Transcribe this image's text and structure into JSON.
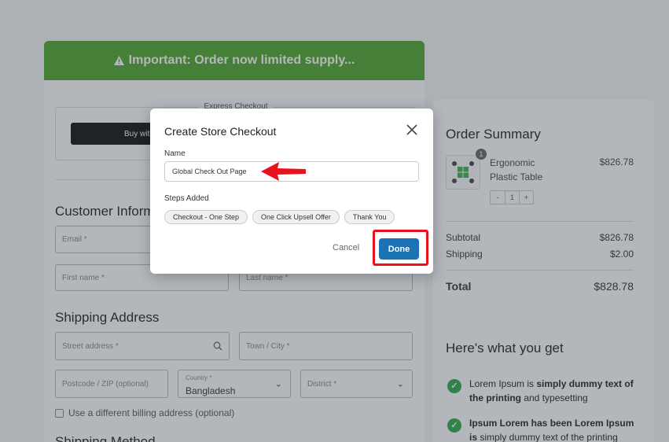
{
  "banner": {
    "icon": "warning-icon",
    "text": "Important: Order now limited supply..."
  },
  "express": {
    "label": "Express Checkout",
    "buy_button": "Buy with"
  },
  "customer": {
    "title": "Customer Inform",
    "email_placeholder": "Email *",
    "first_name_placeholder": "First name *",
    "last_name_placeholder": "Last name *"
  },
  "shipping": {
    "title": "Shipping Address",
    "street_placeholder": "Street address *",
    "town_placeholder": "Town / City *",
    "postcode_placeholder": "Postcode / ZIP (optional)",
    "country_label": "Country *",
    "country_value": "Bangladesh",
    "district_placeholder": "District *",
    "billing_checkbox": "Use a different billing address (optional)",
    "method_title": "Shipping Method"
  },
  "summary": {
    "title": "Order Summary",
    "item_qty_badge": "1",
    "product_name": "Ergonomic Plastic Table",
    "product_price": "$826.78",
    "qty_minus": "-",
    "qty_value": "1",
    "qty_plus": "+",
    "subtotal_label": "Subtotal",
    "subtotal_value": "$826.78",
    "shipping_label": "Shipping",
    "shipping_value": "$2.00",
    "total_label": "Total",
    "total_value": "$828.78"
  },
  "benefits": {
    "title": "Here's what you get",
    "item1_a": "Lorem Ipsum is ",
    "item1_b": "simply dummy text of the printing",
    "item1_c": " and typesetting",
    "item2_a": "Ipsum Lorem has been Lorem Ipsum is",
    "item2_b": " simply dummy text of the printing"
  },
  "modal": {
    "title": "Create Store Checkout",
    "name_label": "Name",
    "name_value": "Global Check Out Page",
    "steps_label": "Steps Added",
    "steps": [
      "Checkout - One Step",
      "One Click Upsell Offer",
      "Thank You"
    ],
    "cancel_label": "Cancel",
    "done_label": "Done"
  },
  "colors": {
    "banner": "#4fa52a",
    "done_button": "#1b72b4",
    "annotation_red": "#e8121c",
    "check_green": "#2ea84a"
  }
}
